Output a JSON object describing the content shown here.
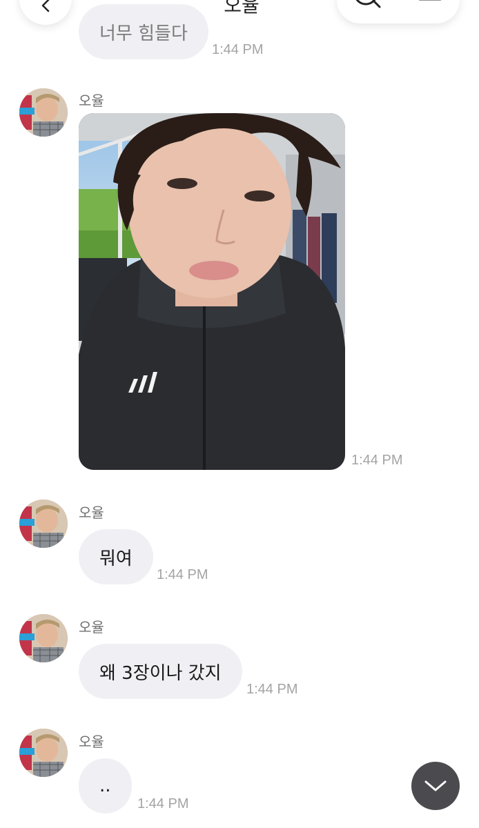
{
  "header": {
    "title": "오율"
  },
  "messages": [
    {
      "text": "너무 힘들다",
      "time": "1:44 PM"
    },
    {
      "sender": "오율",
      "type": "photo",
      "time": "1:44 PM"
    },
    {
      "sender": "오율",
      "text": "뭐여",
      "time": "1:44 PM"
    },
    {
      "sender": "오율",
      "text": "왜 3장이나 갔지",
      "time": "1:44 PM"
    },
    {
      "sender": "오율",
      "text": "..",
      "time": "1:44 PM"
    }
  ],
  "colors": {
    "bubble": "#f0eff4",
    "time": "#a3a3a3",
    "scroll_button": "#4b4b4f"
  },
  "icons": [
    "back-arrow-icon",
    "search-icon",
    "menu-icon",
    "chevron-down-icon"
  ]
}
